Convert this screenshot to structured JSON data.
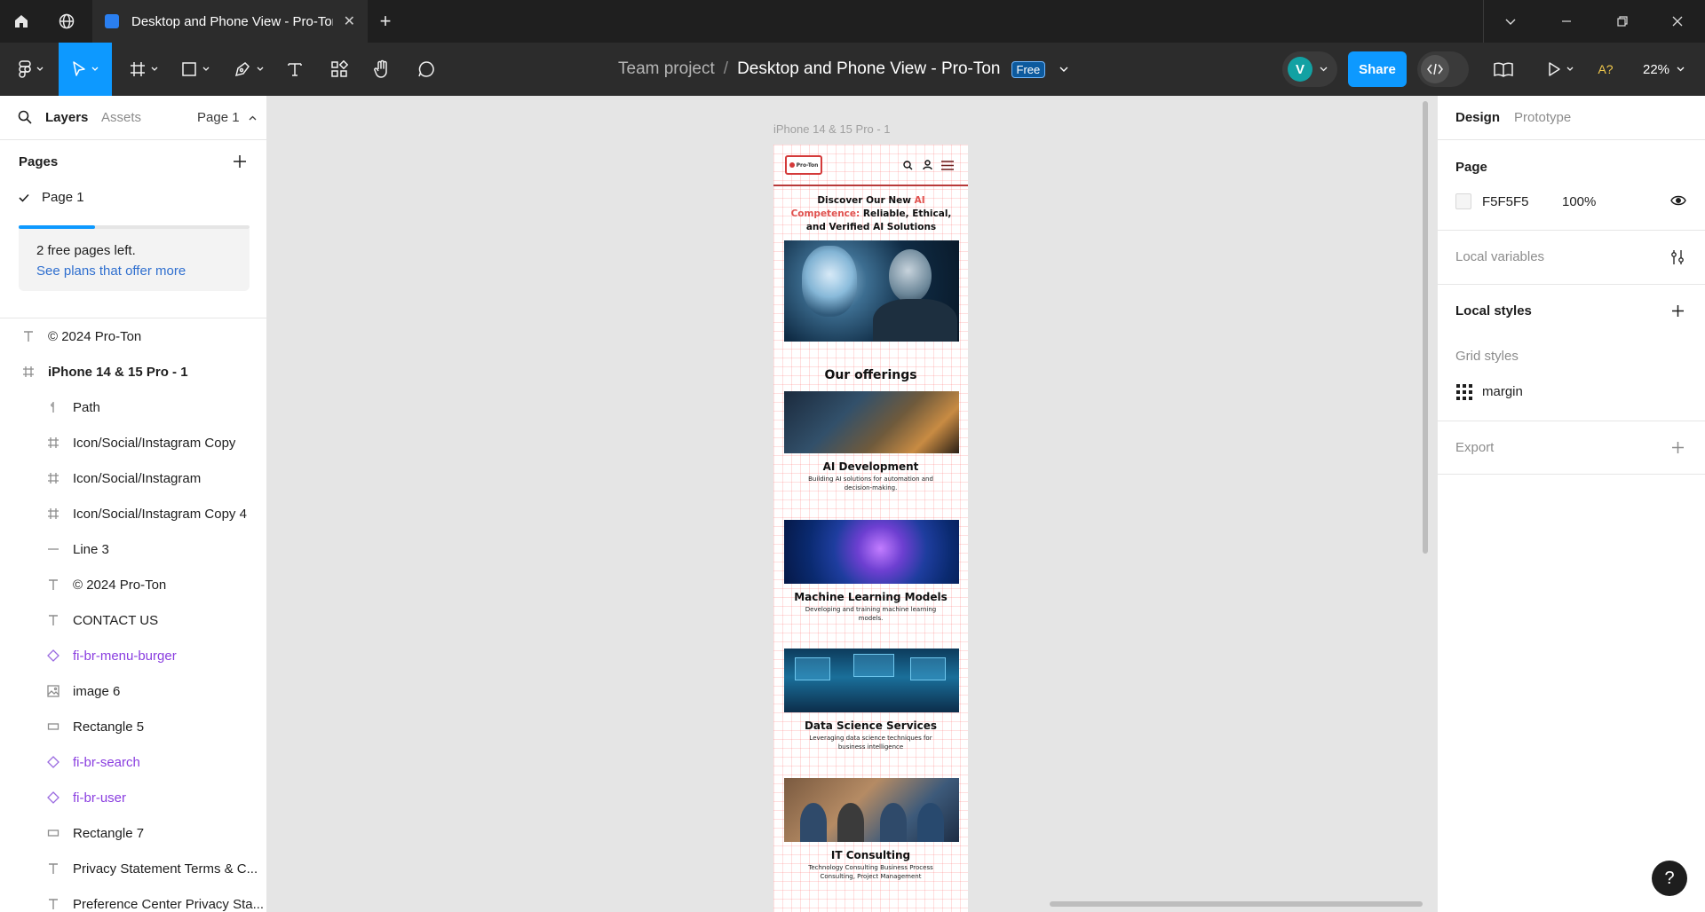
{
  "browser": {
    "tab_title": "Desktop and Phone View - Pro-Ton",
    "tab_close": "✕",
    "new_tab": "+"
  },
  "toolbar": {
    "team": "Team project",
    "slash": "/",
    "file_name": "Desktop and Phone View - Pro-Ton",
    "plan_badge": "Free",
    "avatar_initial": "V",
    "share_label": "Share",
    "zoom": "22%",
    "accessibility_label": "A?"
  },
  "left_panel": {
    "tabs": {
      "layers": "Layers",
      "assets": "Assets"
    },
    "current_page": "Page 1",
    "pages_title": "Pages",
    "pages": [
      {
        "label": "Page 1",
        "selected": true
      }
    ],
    "free_pages_progress": 0.33,
    "free_pages_text": "2 free pages left.",
    "plans_link": "See plans that offer more",
    "layers": [
      {
        "label": "© 2024 Pro-Ton",
        "icon": "text-icon",
        "level": 0
      },
      {
        "label": "iPhone 14 & 15 Pro - 1",
        "icon": "frame-icon",
        "level": 0,
        "bold": true
      },
      {
        "label": "Path",
        "icon": "path-icon",
        "level": 1
      },
      {
        "label": "Icon/Social/Instagram Copy",
        "icon": "frame-icon",
        "level": 1
      },
      {
        "label": "Icon/Social/Instagram",
        "icon": "frame-icon",
        "level": 1
      },
      {
        "label": "Icon/Social/Instagram Copy 4",
        "icon": "frame-icon",
        "level": 1
      },
      {
        "label": "Line 3",
        "icon": "line-icon",
        "level": 1
      },
      {
        "label": "© 2024 Pro-Ton",
        "icon": "text-icon",
        "level": 1
      },
      {
        "label": "CONTACT US",
        "icon": "text-icon",
        "level": 1
      },
      {
        "label": "fi-br-menu-burger",
        "icon": "component-icon",
        "level": 1,
        "component": true
      },
      {
        "label": "image 6",
        "icon": "image-icon",
        "level": 1
      },
      {
        "label": "Rectangle 5",
        "icon": "rectangle-icon",
        "level": 1
      },
      {
        "label": "fi-br-search",
        "icon": "component-icon",
        "level": 1,
        "component": true
      },
      {
        "label": "fi-br-user",
        "icon": "component-icon",
        "level": 1,
        "component": true
      },
      {
        "label": "Rectangle 7",
        "icon": "rectangle-icon",
        "level": 1
      },
      {
        "label": "Privacy Statement Terms & C...",
        "icon": "text-icon",
        "level": 1
      },
      {
        "label": "Preference Center Privacy Sta...",
        "icon": "text-icon",
        "level": 1
      }
    ]
  },
  "canvas": {
    "frame_label": "iPhone 14 & 15 Pro - 1",
    "mobile": {
      "logo_text": "Pro-Ton",
      "hero_line1": "Discover Our New ",
      "hero_accent1": "AI",
      "hero_accent2": "Competence:",
      "hero_line2": " Reliable, Ethical,",
      "hero_line3": "and Verified AI Solutions",
      "offerings_title": "Our offerings",
      "cards": [
        {
          "title": "AI Development",
          "desc": "Building AI solutions for automation and decision-making."
        },
        {
          "title": "Machine Learning Models",
          "desc": "Developing and training machine learning models."
        },
        {
          "title": "Data Science Services",
          "desc": "Leveraging data science techniques for business intelligence"
        },
        {
          "title": "IT Consulting",
          "desc": "Technology Consulting Business Process Consulting, Project Management"
        }
      ]
    }
  },
  "right_panel": {
    "tabs": {
      "design": "Design",
      "prototype": "Prototype"
    },
    "page_section": "Page",
    "page_color": "F5F5F5",
    "page_opacity": "100%",
    "local_variables": "Local variables",
    "local_styles": "Local styles",
    "grid_styles": "Grid styles",
    "grid_style_name": "margin",
    "export": "Export"
  },
  "help_label": "?",
  "colors": {
    "accent": "#0d99ff",
    "component": "#8a3ee0",
    "brand_red": "#e0524f"
  }
}
